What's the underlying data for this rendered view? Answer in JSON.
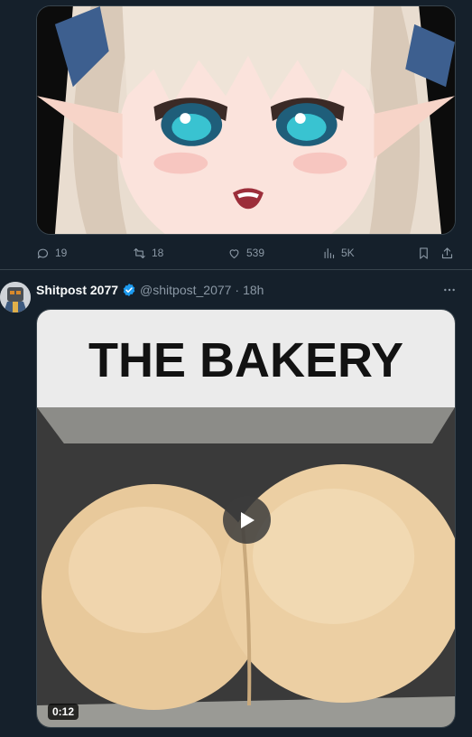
{
  "posts": [
    {
      "stats": {
        "replies": "19",
        "reposts": "18",
        "likes": "539",
        "views": "5K"
      }
    },
    {
      "author": {
        "display_name": "Shitpost 2077",
        "verified": true,
        "handle": "@shitpost_2077",
        "separator": "·",
        "time": "18h"
      },
      "media": {
        "banner_text": "THE BAKERY",
        "duration": "0:12"
      }
    }
  ],
  "colors": {
    "background": "#15202b",
    "border": "#38444d",
    "muted_text": "#8b98a5",
    "verified_badge": "#1d9bf0"
  },
  "icons": [
    "reply-icon",
    "repost-icon",
    "like-icon",
    "views-icon",
    "bookmark-icon",
    "share-icon",
    "verified-icon",
    "more-icon",
    "play-icon"
  ]
}
